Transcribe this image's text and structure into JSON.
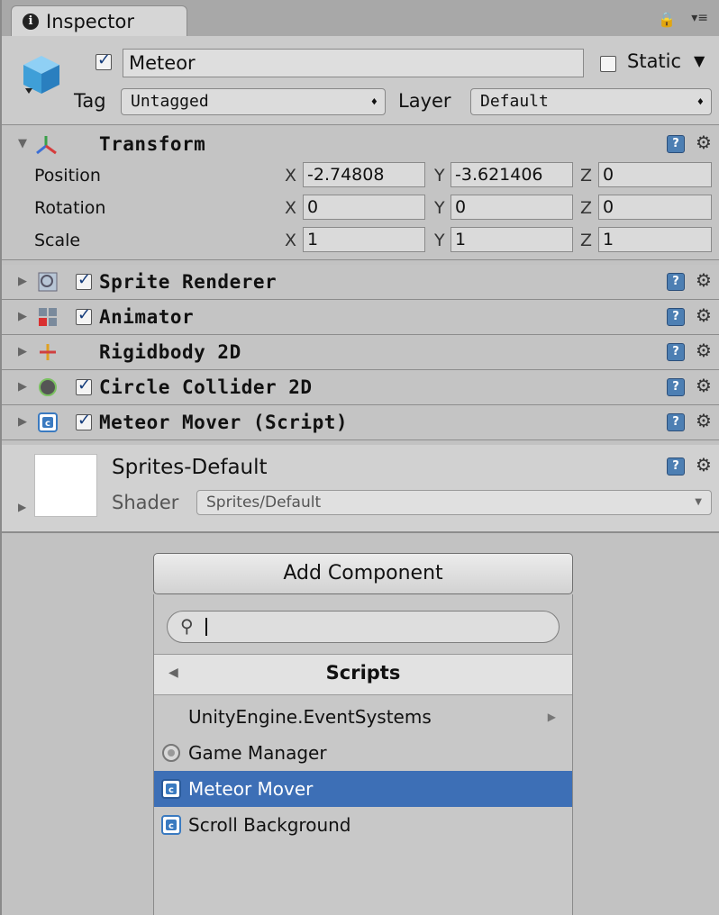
{
  "tab": {
    "title": "Inspector"
  },
  "object": {
    "active": true,
    "name": "Meteor",
    "static_label": "Static",
    "static": false,
    "tag_label": "Tag",
    "tag_value": "Untagged",
    "layer_label": "Layer",
    "layer_value": "Default"
  },
  "transform": {
    "title": "Transform",
    "rows": [
      {
        "label": "Position",
        "x": "-2.74808",
        "y": "-3.621406",
        "z": "0"
      },
      {
        "label": "Rotation",
        "x": "0",
        "y": "0",
        "z": "0"
      },
      {
        "label": "Scale",
        "x": "1",
        "y": "1",
        "z": "1"
      }
    ],
    "axis_x": "X",
    "axis_y": "Y",
    "axis_z": "Z"
  },
  "components": [
    {
      "title": "Sprite Renderer",
      "icon": "sprite-renderer-icon",
      "checkbox": true
    },
    {
      "title": "Animator",
      "icon": "animator-icon",
      "checkbox": true
    },
    {
      "title": "Rigidbody 2D",
      "icon": "rigidbody-icon",
      "checkbox": false
    },
    {
      "title": "Circle Collider 2D",
      "icon": "circle-collider-icon",
      "checkbox": true
    },
    {
      "title": "Meteor Mover (Script)",
      "icon": "script-icon",
      "checkbox": true
    }
  ],
  "material": {
    "name": "Sprites-Default",
    "shader_label": "Shader",
    "shader_value": "Sprites/Default"
  },
  "add_component": {
    "button_label": "Add Component",
    "search_value": "",
    "category": "Scripts",
    "items": [
      {
        "label": "UnityEngine.EventSystems",
        "icon": "none",
        "submenu": true,
        "selected": false
      },
      {
        "label": "Game Manager",
        "icon": "gear-script-icon",
        "submenu": false,
        "selected": false
      },
      {
        "label": "Meteor Mover",
        "icon": "script-icon",
        "submenu": false,
        "selected": true
      },
      {
        "label": "Scroll Background",
        "icon": "script-icon",
        "submenu": false,
        "selected": false
      }
    ]
  },
  "colors": {
    "selection": "#3d6fb6",
    "panel": "#c4c4c4",
    "help_icon": "#4d7fb3"
  }
}
